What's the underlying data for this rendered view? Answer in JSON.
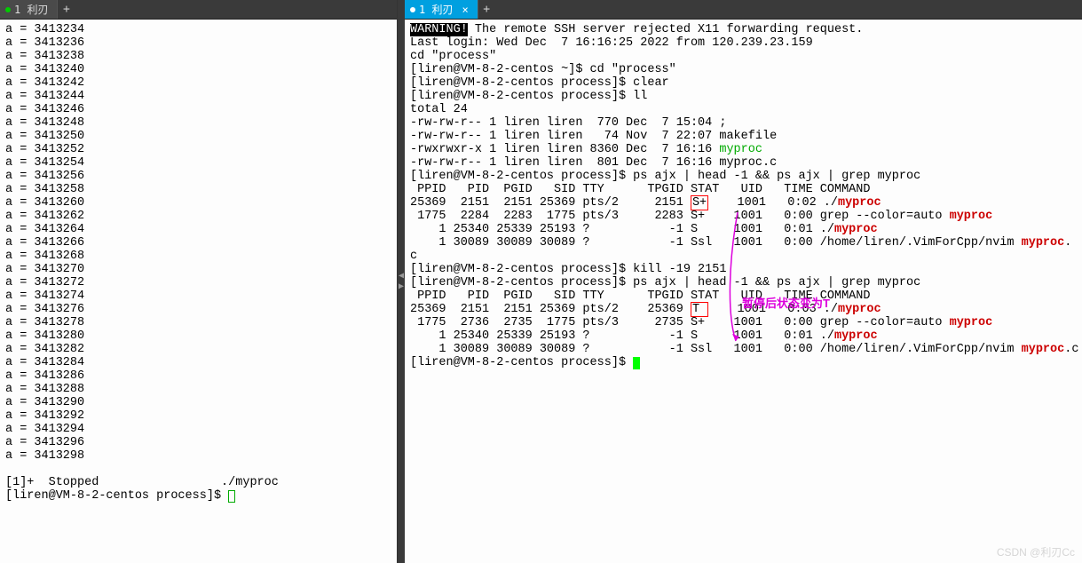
{
  "left_pane": {
    "tab_label": "1 利刃",
    "lines_var": "a",
    "line_values": [
      3413234,
      3413236,
      3413238,
      3413240,
      3413242,
      3413244,
      3413246,
      3413248,
      3413250,
      3413252,
      3413254,
      3413256,
      3413258,
      3413260,
      3413262,
      3413264,
      3413266,
      3413268,
      3413270,
      3413272,
      3413274,
      3413276,
      3413278,
      3413280,
      3413282,
      3413284,
      3413286,
      3413288,
      3413290,
      3413292,
      3413294,
      3413296,
      3413298
    ],
    "stopped_line": "[1]+  Stopped                 ./myproc",
    "prompt": "[liren@VM-8-2-centos process]$ "
  },
  "right_pane": {
    "tab_label": "1 利刃",
    "warning_tag": "WARNING!",
    "warning_rest": " The remote SSH server rejected X11 forwarding request.",
    "login_line": "Last login: Wed Dec  7 16:16:25 2022 from 120.239.23.159",
    "cd_echo": "cd \"process\"",
    "prompt_home": "[liren@VM-8-2-centos ~]$ ",
    "prompt_proc": "[liren@VM-8-2-centos process]$ ",
    "cmd_cd": "cd \"process\"",
    "cmd_clear": "clear",
    "cmd_ll": "ll",
    "total_line": "total 24",
    "ls_rows": [
      {
        "perm": "-rw-rw-r-- 1 liren liren  770 Dec  7 15:04 ",
        "name": ";",
        "cls": ""
      },
      {
        "perm": "-rw-rw-r-- 1 liren liren   74 Nov  7 22:07 ",
        "name": "makefile",
        "cls": ""
      },
      {
        "perm": "-rwxrwxr-x 1 liren liren 8360 Dec  7 16:16 ",
        "name": "myproc",
        "cls": "hl-green"
      },
      {
        "perm": "-rw-rw-r-- 1 liren liren  801 Dec  7 16:16 ",
        "name": "myproc.c",
        "cls": ""
      }
    ],
    "cmd_ps": "ps ajx | head -1 && ps ajx | grep myproc",
    "ps_header": " PPID   PID  PGID   SID TTY      TPGID STAT   UID   TIME COMMAND",
    "ps_rows_1": [
      {
        "pre": "25369  2151  2151 25369 pts/2     2151 ",
        "stat": "S+",
        "stat_box": true,
        "post": "    1001   0:02 ./",
        "tail": "myproc",
        "tail2": ""
      },
      {
        "pre": " 1775  2284  2283  1775 pts/3     2283 ",
        "stat": "S+",
        "stat_box": false,
        "post": "    1001   0:00 grep --color=auto ",
        "tail": "myproc",
        "tail2": ""
      },
      {
        "pre": "    1 25340 25339 25193 ?           -1 ",
        "stat": "S ",
        "stat_box": false,
        "post": "    1001   0:01 ./",
        "tail": "myproc",
        "tail2": ""
      },
      {
        "pre": "    1 30089 30089 30089 ?           -1 ",
        "stat": "Ssl",
        "stat_box": false,
        "post": "   1001   0:00 /home/liren/.VimForCpp/nvim ",
        "tail": "myproc",
        "tail2": "."
      }
    ],
    "wrap_c": "c",
    "cmd_kill": "kill -19 2151",
    "annotation_text": "暂停后状态变为T",
    "ps_rows_2": [
      {
        "pre": "25369  2151  2151 25369 pts/2    25369 ",
        "stat": "T ",
        "stat_box": true,
        "post": "    1001   0:03 ./",
        "tail": "myproc",
        "tail2": ""
      },
      {
        "pre": " 1775  2736  2735  1775 pts/3     2735 ",
        "stat": "S+",
        "stat_box": false,
        "post": "    1001   0:00 grep --color=auto ",
        "tail": "myproc",
        "tail2": ""
      },
      {
        "pre": "    1 25340 25339 25193 ?           -1 ",
        "stat": "S ",
        "stat_box": false,
        "post": "    1001   0:01 ./",
        "tail": "myproc",
        "tail2": ""
      },
      {
        "pre": "    1 30089 30089 30089 ?           -1 ",
        "stat": "Ssl",
        "stat_box": false,
        "post": "   1001   0:00 /home/liren/.VimForCpp/nvim ",
        "tail": "myproc",
        "tail2": ".c"
      }
    ]
  },
  "watermark": "CSDN @利刃Cc"
}
